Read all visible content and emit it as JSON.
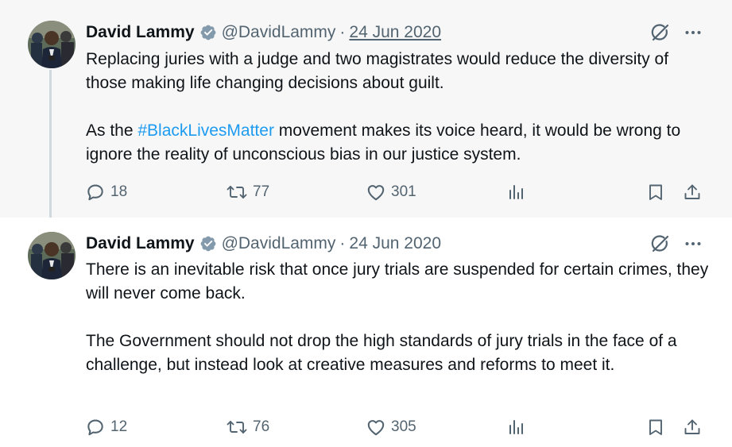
{
  "tweets": [
    {
      "author_name": "David Lammy",
      "handle": "@DavidLammy",
      "separator": "·",
      "date": "24 Jun 2020",
      "text_1_before": "Replacing juries with a judge and two magistrates would reduce the diversity of those making life changing decisions about guilt.",
      "text_2_before": "As the ",
      "hashtag": "#BlackLivesMatter",
      "text_2_after": " movement makes its voice heard, it would be wrong to ignore the reality of unconscious bias in our justice system.",
      "replies": "18",
      "reposts": "77",
      "likes": "301"
    },
    {
      "author_name": "David Lammy",
      "handle": "@DavidLammy",
      "separator": "·",
      "date": "24 Jun 2020",
      "text_1": "There is an inevitable risk that once jury trials are suspended for certain crimes, they will never come back.",
      "text_2": "The Government should not drop the high standards of jury trials in the face of a challenge, but instead look at creative measures and reforms to meet it.",
      "replies": "12",
      "reposts": "76",
      "likes": "305"
    }
  ],
  "colors": {
    "text_primary": "#0f1419",
    "text_secondary": "#536471",
    "hashtag": "#1d9bf0",
    "verified_badge": "#829aab",
    "thread_line": "#cfd9de"
  },
  "icons": [
    "verified-badge-icon",
    "grok-icon",
    "more-icon",
    "reply-icon",
    "retweet-icon",
    "like-icon",
    "views-icon",
    "bookmark-icon",
    "share-icon"
  ]
}
